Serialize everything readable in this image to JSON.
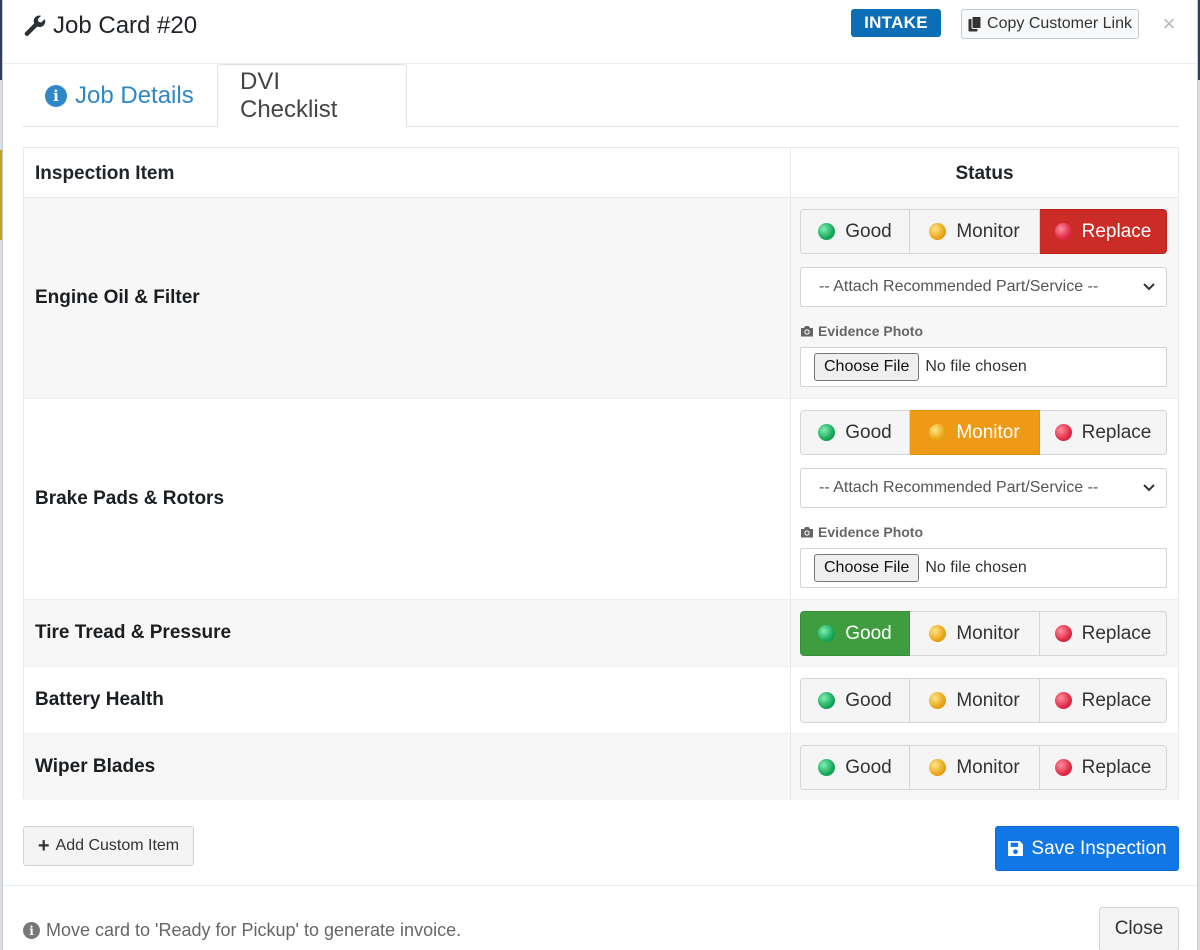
{
  "header": {
    "title": "Job Card #20",
    "status_badge": "INTAKE",
    "copy_link_label": "Copy Customer Link",
    "close_symbol": "×"
  },
  "tabs": [
    {
      "label": "Job Details",
      "icon": "info-icon",
      "active": false
    },
    {
      "label": "DVI Checklist",
      "active": true
    }
  ],
  "table": {
    "col_item": "Inspection Item",
    "col_status": "Status"
  },
  "status_options": {
    "good": "Good",
    "monitor": "Monitor",
    "replace": "Replace"
  },
  "rows": [
    {
      "label": "Engine Oil & Filter",
      "selected": "replace",
      "expanded": true,
      "recommend_select": "-- Attach Recommended Part/Service --",
      "evidence_label": "Evidence Photo",
      "choose_file": "Choose File",
      "no_file": "No file chosen"
    },
    {
      "label": "Brake Pads & Rotors",
      "selected": "monitor",
      "expanded": true,
      "recommend_select": "-- Attach Recommended Part/Service --",
      "evidence_label": "Evidence Photo",
      "choose_file": "Choose File",
      "no_file": "No file chosen"
    },
    {
      "label": "Tire Tread & Pressure",
      "selected": "good",
      "expanded": false
    },
    {
      "label": "Battery Health",
      "selected": "",
      "expanded": false
    },
    {
      "label": "Wiper Blades",
      "selected": "",
      "expanded": false
    }
  ],
  "actions": {
    "add_custom": "Add Custom Item",
    "save": "Save Inspection"
  },
  "footer": {
    "note": "Move card to 'Ready for Pickup' to generate invoice.",
    "close": "Close"
  },
  "colors": {
    "badge": "#0d6eb8",
    "good_active": "#3f9c3f",
    "monitor_active": "#ee9a17",
    "replace_active": "#cc2c26",
    "primary": "#1177e6"
  }
}
